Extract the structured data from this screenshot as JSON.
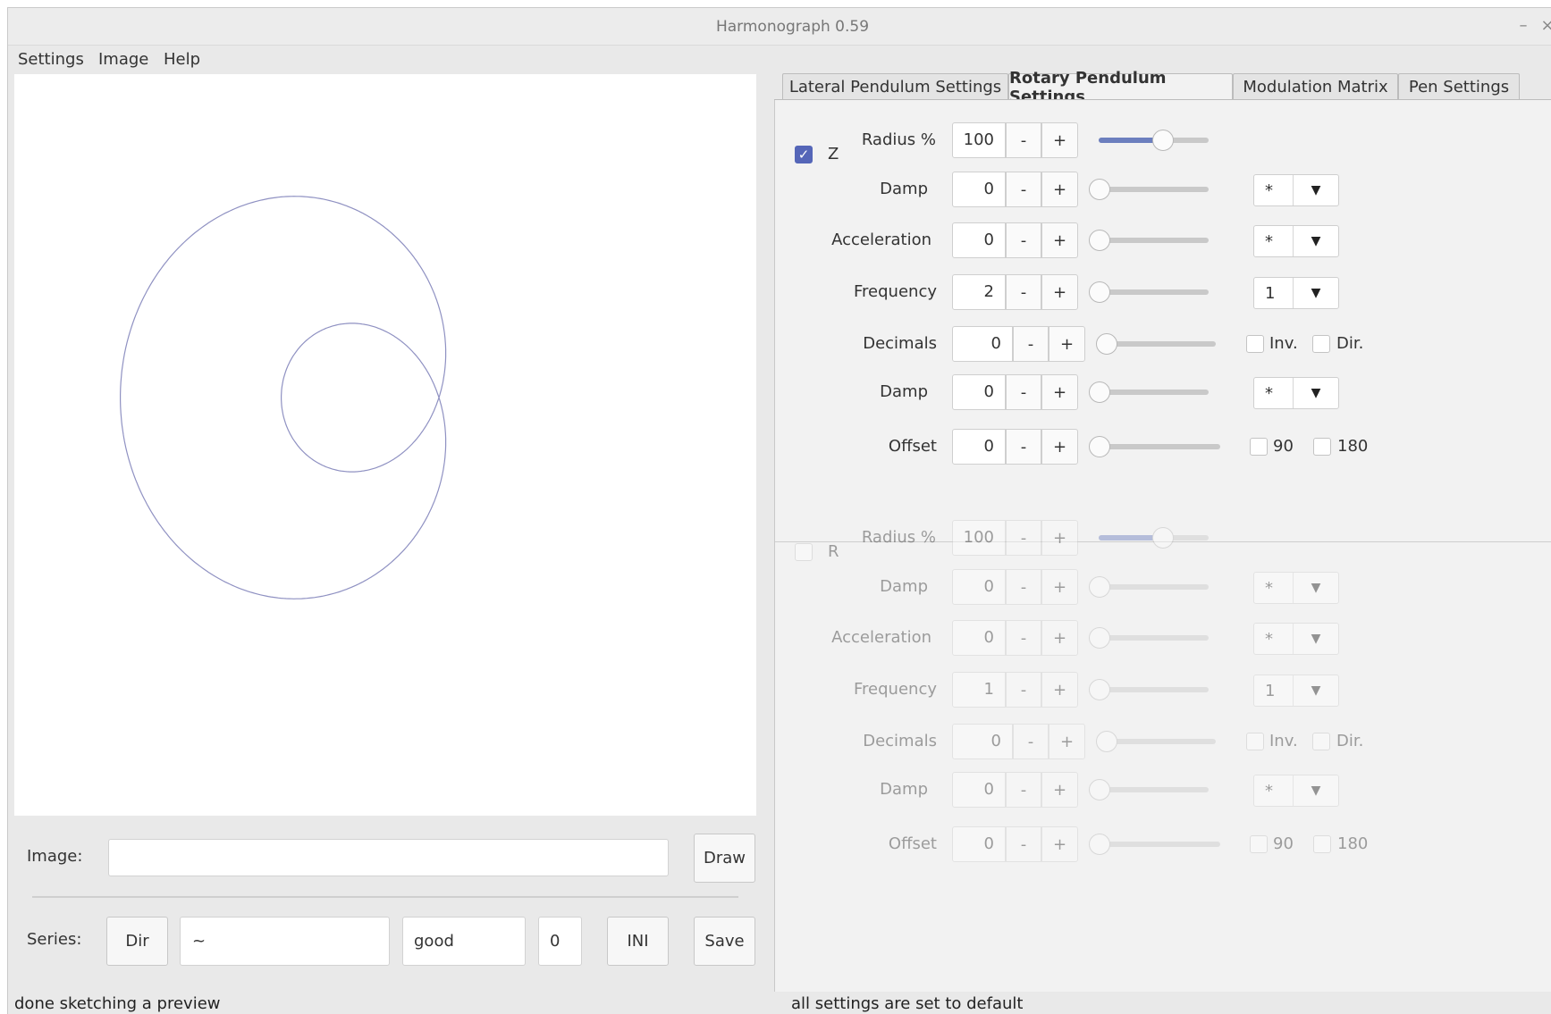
{
  "window": {
    "title": "Harmonograph 0.59",
    "minimize_icon": "–",
    "close_icon": "×"
  },
  "menu": {
    "items": [
      "Settings",
      "Image",
      "Help"
    ]
  },
  "left": {
    "image_label": "Image:",
    "image_value": "",
    "draw_label": "Draw",
    "series_label": "Series:",
    "dir_label": "Dir",
    "path_value": "~",
    "name_value": "good",
    "index_value": "0",
    "ini_label": "INI",
    "save_label": "Save",
    "curve_color": "#8f91c2"
  },
  "tabs": [
    {
      "label": "Lateral Pendulum Settings",
      "active": false
    },
    {
      "label": "Rotary Pendulum Settings",
      "active": true
    },
    {
      "label": "Modulation Matrix",
      "active": false
    },
    {
      "label": "Pen Settings",
      "active": false
    }
  ],
  "pendulums": [
    {
      "enabled": true,
      "name": "Z",
      "rows": {
        "radius": {
          "label": "Radius %",
          "value": "100",
          "slider": 0.65
        },
        "damp1": {
          "label": "Damp",
          "value": "0",
          "slider": 0,
          "combo": "*"
        },
        "accel": {
          "label": "Acceleration",
          "value": "0",
          "slider": 0,
          "combo": "*"
        },
        "freq": {
          "label": "Frequency",
          "value": "2",
          "slider": 0,
          "combo": "1"
        },
        "decimals": {
          "label": "Decimals",
          "value": "0",
          "slider": 0,
          "inv": "Inv.",
          "dir": "Dir."
        },
        "damp2": {
          "label": "Damp",
          "value": "0",
          "slider": 0,
          "combo": "*"
        },
        "offset": {
          "label": "Offset",
          "value": "0",
          "slider": 0,
          "c90": "90",
          "c180": "180"
        }
      }
    },
    {
      "enabled": false,
      "name": "R",
      "rows": {
        "radius": {
          "label": "Radius %",
          "value": "100",
          "slider": 0.65
        },
        "damp1": {
          "label": "Damp",
          "value": "0",
          "slider": 0,
          "combo": "*"
        },
        "accel": {
          "label": "Acceleration",
          "value": "0",
          "slider": 0,
          "combo": "*"
        },
        "freq": {
          "label": "Frequency",
          "value": "1",
          "slider": 0,
          "combo": "1"
        },
        "decimals": {
          "label": "Decimals",
          "value": "0",
          "slider": 0,
          "inv": "Inv.",
          "dir": "Dir."
        },
        "damp2": {
          "label": "Damp",
          "value": "0",
          "slider": 0,
          "combo": "*"
        },
        "offset": {
          "label": "Offset",
          "value": "0",
          "slider": 0,
          "c90": "90",
          "c180": "180"
        }
      }
    }
  ],
  "controls": {
    "minus": "-",
    "plus": "+",
    "combo_arrow": "▼",
    "check": "✓"
  },
  "status": {
    "left": "done sketching a preview",
    "right": "all settings are set to default"
  }
}
